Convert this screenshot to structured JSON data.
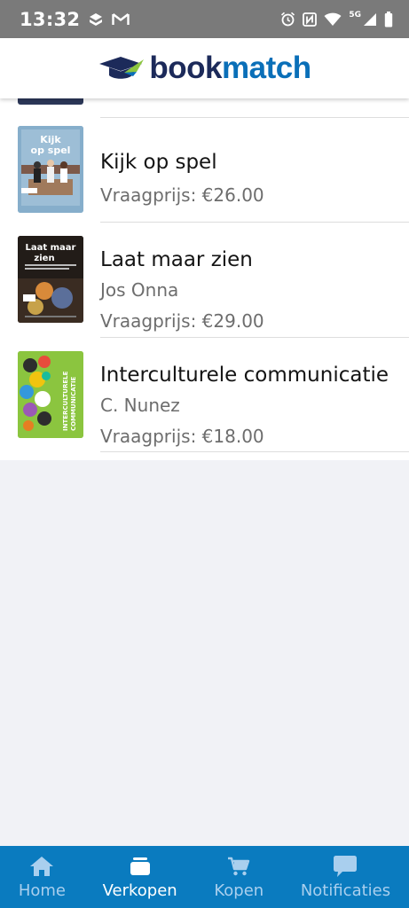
{
  "status_bar": {
    "time": "13:32",
    "network": "5G",
    "icons": [
      "notification-icon",
      "gmail-icon",
      "alarm-icon",
      "nfc-icon",
      "wifi-icon",
      "signal-icon",
      "battery-icon"
    ]
  },
  "header": {
    "logo_part1": "book",
    "logo_part2": "match",
    "logo_icon": "graduation-cap-icon"
  },
  "books": [
    {
      "title": "Kijk op spel",
      "author": "",
      "price": "Vraagprijs: €26.00",
      "cover_title": "Kijk op spel"
    },
    {
      "title": "Laat maar zien",
      "author": "Jos Onna",
      "price": "Vraagprijs: €29.00",
      "cover_title": "Laat maar zien",
      "cover_subtitle": "Procesgerichte didactiek voor kunstzinnige oriëntatie"
    },
    {
      "title": "Interculturele communicatie",
      "author": "C. Nunez",
      "price": "Vraagprijs: €18.00",
      "cover_title": "INTERCULTURELE COMMUNICATIE"
    }
  ],
  "nav": {
    "items": [
      {
        "label": "Home",
        "icon": "home-icon",
        "active": false
      },
      {
        "label": "Verkopen",
        "icon": "inbox-icon",
        "active": true
      },
      {
        "label": "Kopen",
        "icon": "cart-icon",
        "active": false
      },
      {
        "label": "Notificaties",
        "icon": "chat-icon",
        "active": false
      }
    ]
  },
  "colors": {
    "brand_dark": "#1c2a5a",
    "brand_blue": "#0a6fb8",
    "nav_bg": "#0a7bbf",
    "nav_inactive": "#a9cfee",
    "page_bg": "#f1f2f6"
  }
}
